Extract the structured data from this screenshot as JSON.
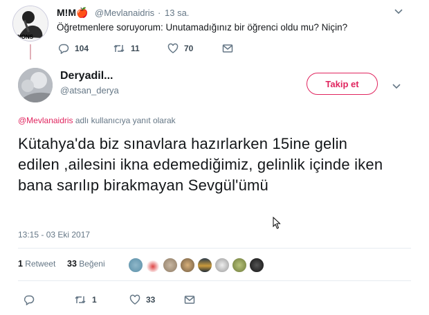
{
  "parent": {
    "name": "M!M🍎",
    "handle": "@Mevlanaidris",
    "dot": "·",
    "time": "13 sa.",
    "text": "Öğretmenlere soruyorum: Unutamadığınız bir öğrenci oldu mu? Niçin?",
    "avatar_text": "NONS",
    "replies": "104",
    "retweets": "11",
    "likes": "70"
  },
  "tweet": {
    "name": "Deryadil...",
    "handle": "@atsan_derya",
    "follow_label": "Takip et",
    "reply_mention": "@Mevlanaidris",
    "reply_suffix": " adlı kullanıcıya yanıt olarak",
    "text": "Kütahya'da biz sınavlara hazırlarken 15ine gelin edilen ,ailesini ikna edemediğimiz, gelinlik içinde iken bana sarılıp birakmayan Sevgül'ümü",
    "date": "13:15 - 03 Eki 2017",
    "retweet_count": "1",
    "retweet_label": "Retweet",
    "like_count": "33",
    "like_label": "Beğeni",
    "action_retweets": "1",
    "action_likes": "33"
  },
  "colors": {
    "accent": "#e0245e",
    "muted": "#657786",
    "divider": "#e6ecf0"
  }
}
